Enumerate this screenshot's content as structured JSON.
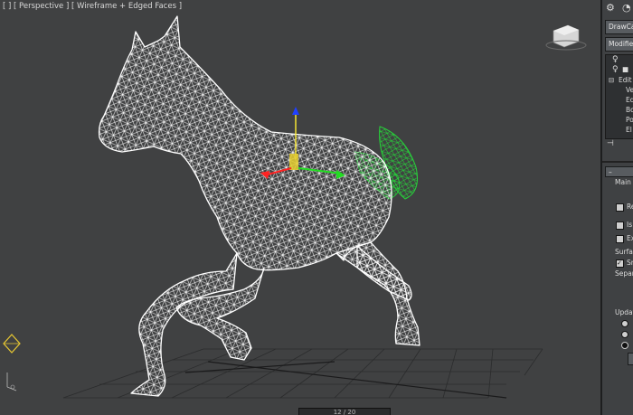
{
  "viewport": {
    "label": "[ ] [ Perspective ] [ Wireframe + Edged Faces ]",
    "timeline_position": "12 / 20"
  },
  "panel": {
    "dropdown_top": "DrawCal",
    "modifier_list": "Modifier",
    "stack_items": [
      "Edit",
      "Ve",
      "Ed",
      "Bo",
      "Po",
      "El"
    ],
    "rollout_main": "Main",
    "opt_re": "Re",
    "opt_is": "Is",
    "opt_ex": "Ex",
    "group_surface": "Surfac",
    "opt_sm": "Sm",
    "group_separate": "Separ",
    "group_update": "Updat"
  },
  "colors": {
    "viewport_bg": "#404142",
    "wire": "#ffffff",
    "selection": "#22cc33"
  }
}
